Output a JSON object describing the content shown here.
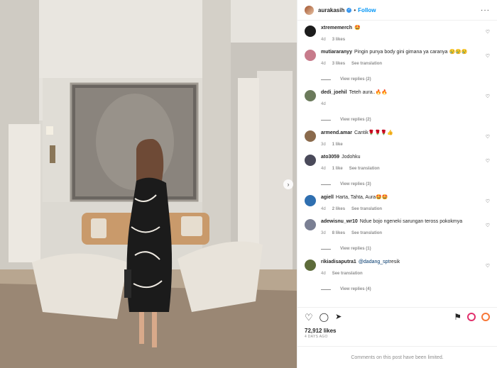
{
  "header": {
    "username": "aurakasih",
    "separator": "•",
    "follow_label": "Follow",
    "more_label": "···"
  },
  "photo": {
    "carousel_next_label": "›"
  },
  "comments": [
    {
      "user": "xtrememerch",
      "text": "🤩",
      "age": "4d",
      "likes": "3 likes",
      "translate": "",
      "replies": "",
      "avatar_color": "#1c1c1c"
    },
    {
      "user": "mutiararanyy",
      "text": "Pingin punya body gini gimana ya caranya 😢😢😢",
      "age": "4d",
      "likes": "3 likes",
      "translate": "See translation",
      "replies": "View replies (2)",
      "avatar_color": "#c77b8b"
    },
    {
      "user": "dedi_joehil",
      "text": "Teteh aura..🔥🔥",
      "age": "4d",
      "likes": "",
      "translate": "",
      "replies": "View replies (2)",
      "avatar_color": "#6b7a5b"
    },
    {
      "user": "armend.amar",
      "text": "Cantik🌹🌹🌹👍",
      "age": "3d",
      "likes": "1 like",
      "translate": "",
      "replies": "",
      "avatar_color": "#8a6a4c"
    },
    {
      "user": "ato3059",
      "text": "Jodohku",
      "age": "4d",
      "likes": "1 like",
      "translate": "See translation",
      "replies": "View replies (3)",
      "avatar_color": "#4a4a5a"
    },
    {
      "user": "agiell",
      "text": "Harta, Tahta, Aura🤩🤩",
      "age": "4d",
      "likes": "2 likes",
      "translate": "See translation",
      "replies": "",
      "avatar_color": "#2f6fb0"
    },
    {
      "user": "adewisnu_wr10",
      "text": "Ndue bojo ngeneki sarungan teross pokokmya",
      "age": "3d",
      "likes": "8 likes",
      "translate": "See translation",
      "replies": "View replies (1)",
      "avatar_color": "#7a7f93"
    },
    {
      "user": "rikiadisaputra1",
      "text_prefix": "",
      "mention": "@dadang_spt",
      "text": "resik",
      "age": "4d",
      "likes": "",
      "translate": "See translation",
      "replies": "View replies (4)",
      "avatar_color": "#5d6b3a"
    }
  ],
  "icons": {
    "heart": "♡",
    "comment": "◯",
    "share": "➤",
    "save": "⛉"
  },
  "footer": {
    "likes": "72,912 likes",
    "date": "4 DAYS AGO",
    "limited_notice": "Comments on this post have been limited."
  }
}
